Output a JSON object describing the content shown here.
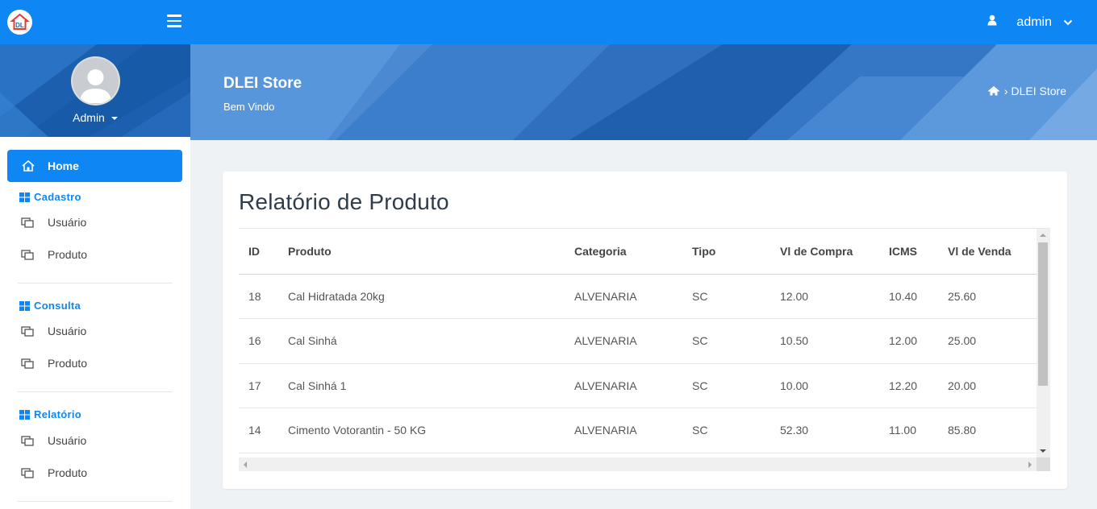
{
  "header": {
    "user_name": "admin",
    "icons": {
      "logo": "store-logo-icon",
      "menu": "hamburger-icon",
      "user": "user-icon",
      "caret": "chevron-down-icon"
    }
  },
  "sidebar": {
    "profile_name": "Admin",
    "home_label": "Home",
    "sections": [
      {
        "title": "Cadastro",
        "items": [
          {
            "label": "Usuário"
          },
          {
            "label": "Produto"
          }
        ]
      },
      {
        "title": "Consulta",
        "items": [
          {
            "label": "Usuário"
          },
          {
            "label": "Produto"
          }
        ]
      },
      {
        "title": "Relatório",
        "items": [
          {
            "label": "Usuário"
          },
          {
            "label": "Produto"
          }
        ]
      }
    ]
  },
  "banner": {
    "title": "DLEI Store",
    "subtitle": "Bem Vindo",
    "breadcrumb_sep": "›",
    "breadcrumb": "DLEI Store"
  },
  "report": {
    "title": "Relatório de Produto",
    "columns": [
      "ID",
      "Produto",
      "Categoria",
      "Tipo",
      "Vl de Compra",
      "ICMS",
      "Vl de Venda"
    ],
    "rows": [
      [
        "18",
        "Cal Hidratada 20kg",
        "ALVENARIA",
        "SC",
        "12.00",
        "10.40",
        "25.60"
      ],
      [
        "16",
        "Cal Sinhá",
        "ALVENARIA",
        "SC",
        "10.50",
        "12.00",
        "25.00"
      ],
      [
        "17",
        "Cal Sinhá 1",
        "ALVENARIA",
        "SC",
        "10.00",
        "12.20",
        "20.00"
      ],
      [
        "14",
        "Cimento Votorantin - 50 KG",
        "ALVENARIA",
        "SC",
        "52.30",
        "11.00",
        "85.80"
      ]
    ]
  },
  "colors": {
    "primary": "#0e87f4",
    "banner": "#3c7fcc",
    "heading": "#2f3d4a"
  }
}
